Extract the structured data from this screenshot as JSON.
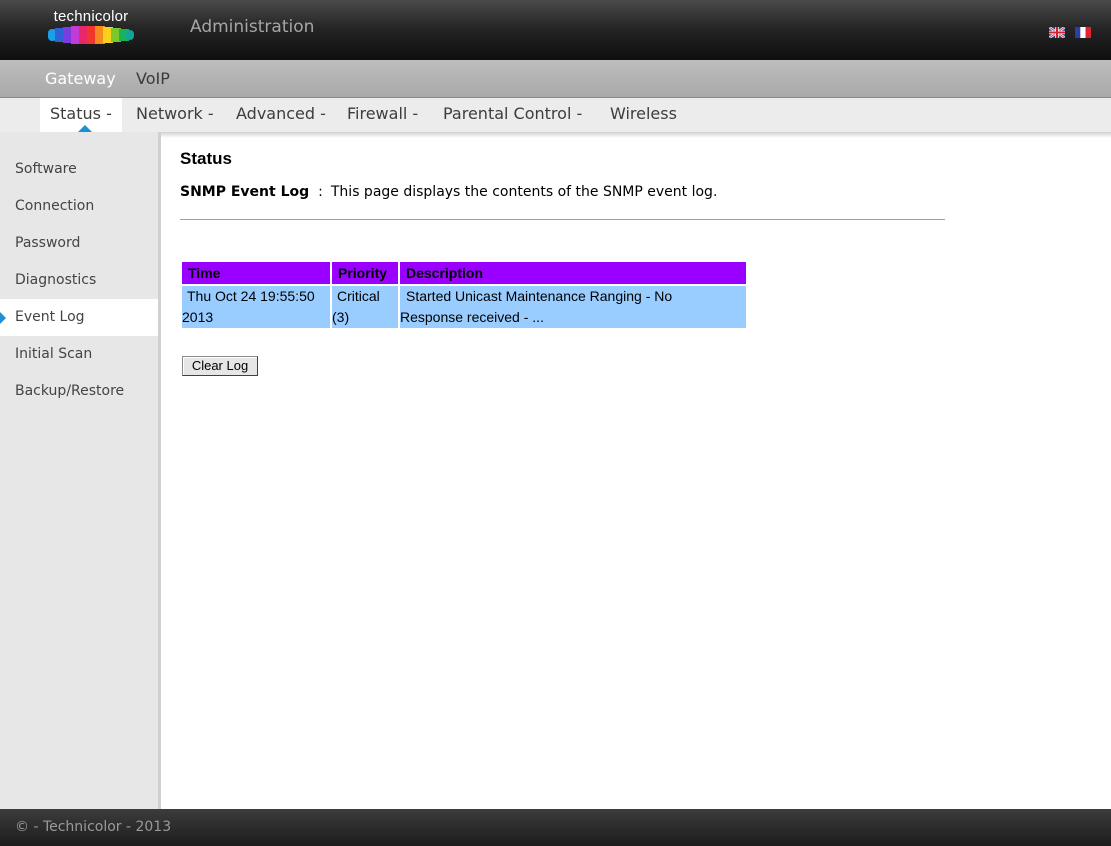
{
  "header": {
    "brand": "technicolor",
    "title": "Administration",
    "languages": [
      {
        "icon": "uk-flag-icon"
      },
      {
        "icon": "france-flag-icon"
      }
    ]
  },
  "subnav": {
    "items": [
      {
        "label": "Gateway",
        "active": true
      },
      {
        "label": "VoIP",
        "active": false
      }
    ]
  },
  "nav": {
    "tabs": [
      {
        "label": "Status -",
        "active": true
      },
      {
        "label": "Network -",
        "active": false
      },
      {
        "label": "Advanced -",
        "active": false
      },
      {
        "label": "Firewall -",
        "active": false
      },
      {
        "label": "Parental Control -",
        "active": false
      },
      {
        "label": "Wireless",
        "active": false
      }
    ]
  },
  "sidebar": {
    "items": [
      {
        "label": "Software",
        "active": false
      },
      {
        "label": "Connection",
        "active": false
      },
      {
        "label": "Password",
        "active": false
      },
      {
        "label": "Diagnostics",
        "active": false
      },
      {
        "label": "Event Log",
        "active": true
      },
      {
        "label": "Initial Scan",
        "active": false
      },
      {
        "label": "Backup/Restore",
        "active": false
      }
    ]
  },
  "content": {
    "title": "Status",
    "section_label": "SNMP Event Log",
    "separator": ":",
    "description": "This page displays the contents of the SNMP event log.",
    "table": {
      "headers": [
        "Time",
        "Priority",
        "Description"
      ],
      "rows": [
        {
          "time_line1": "Thu Oct 24 19:55:50",
          "time_line2": "2013",
          "priority_line1": "Critical",
          "priority_line2": "(3)",
          "desc_line1": "Started Unicast Maintenance Ranging - No",
          "desc_line2": "Response received - ..."
        }
      ]
    },
    "clear_button": "Clear Log"
  },
  "footer": {
    "text": "© - Technicolor - 2013"
  },
  "colors": {
    "accent": "#1e90d2",
    "table_header": "#9900ff",
    "table_row": "#99ccff"
  }
}
